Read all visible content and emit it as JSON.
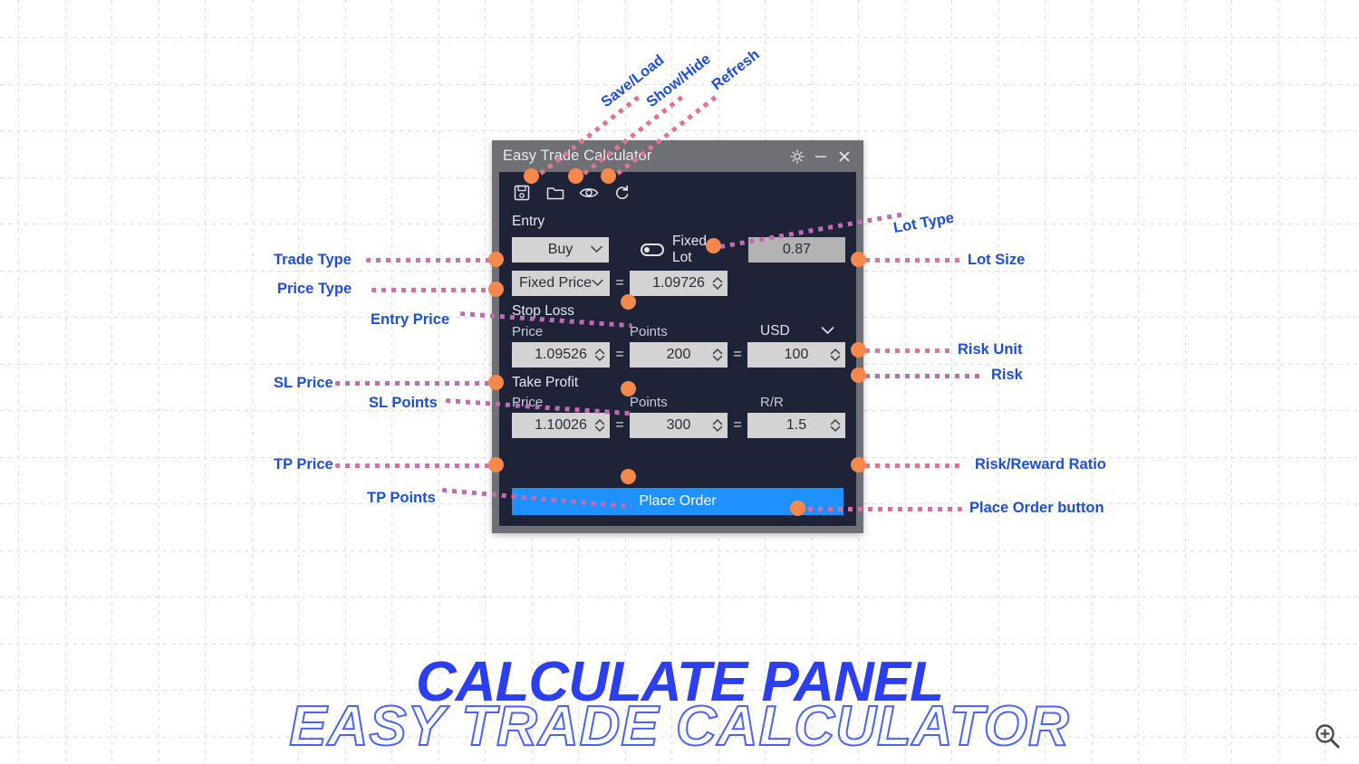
{
  "window": {
    "title": "Easy Trade Calculator",
    "controls": [
      {
        "name": "theme-toggle",
        "glyph": "sun-icon"
      },
      {
        "name": "minimize",
        "glyph": "minimize-icon"
      },
      {
        "name": "close",
        "glyph": "close-icon"
      }
    ]
  },
  "toolbar": {
    "icons": [
      {
        "name": "save-icon",
        "tip": "Save"
      },
      {
        "name": "open-folder-icon",
        "tip": "Load"
      },
      {
        "name": "eye-icon",
        "tip": "Show/Hide"
      },
      {
        "name": "refresh-icon",
        "tip": "Refresh"
      }
    ]
  },
  "entry": {
    "section_label": "Entry",
    "trade_type": "Buy",
    "price_type": "Fixed Price",
    "fixed_lot_label": "Fixed Lot",
    "fixed_lot_on": false,
    "lot_size": "0.87",
    "equals": "=",
    "entry_price": "1.09726"
  },
  "stop_loss": {
    "section_label": "Stop Loss",
    "price_header": "Price",
    "points_header": "Points",
    "unit_header": "USD",
    "price": "1.09526",
    "points": "200",
    "risk": "100",
    "equals": "="
  },
  "take_profit": {
    "section_label": "Take Profit",
    "price_header": "Price",
    "points_header": "Points",
    "rr_header": "R/R",
    "price": "1.10026",
    "points": "300",
    "rr": "1.5",
    "equals": "="
  },
  "place_order": {
    "label": "Place Order"
  },
  "annotations": {
    "save_load": "Save/Load",
    "show_hide": "Show/Hide",
    "refresh": "Refresh",
    "trade_type": "Trade Type",
    "price_type": "Price Type",
    "entry_price": "Entry Price",
    "sl_price": "SL Price",
    "sl_points": "SL Points",
    "tp_price": "TP Price",
    "tp_points": "TP Points",
    "lot_type": "Lot Type",
    "lot_size": "Lot Size",
    "risk_unit": "Risk Unit",
    "risk": "Risk",
    "risk_reward_ratio": "Risk/Reward Ratio",
    "place_order_button": "Place Order button"
  },
  "caption": {
    "main": "CALCULATE PANEL",
    "sub": "EASY TRADE CALCULATOR"
  },
  "zoom_badge": {
    "name": "zoom-in-icon"
  },
  "colors": {
    "accent_blue": "#2b3ef0",
    "dot_orange": "#f5884a",
    "panel_bg": "#1e2337",
    "titlebar": "#6f6f76",
    "button_blue": "#1e90ff",
    "field_gray": "#d3d3d3"
  }
}
